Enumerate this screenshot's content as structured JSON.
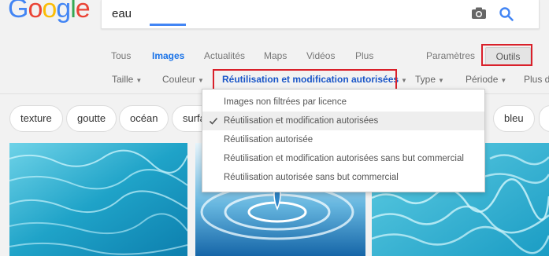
{
  "logo": {
    "text": "Google",
    "letters": [
      "G",
      "o",
      "o",
      "g",
      "l",
      "e"
    ],
    "colors": [
      "#4285F4",
      "#EA4335",
      "#FBBC05",
      "#4285F4",
      "#34A853",
      "#EA4335"
    ]
  },
  "search": {
    "query": "eau",
    "camera_icon": "camera-icon",
    "search_icon": "search-icon"
  },
  "tabs": [
    {
      "label": "Tous"
    },
    {
      "label": "Images",
      "active": true
    },
    {
      "label": "Actualités"
    },
    {
      "label": "Maps"
    },
    {
      "label": "Vidéos"
    },
    {
      "label": "Plus"
    },
    {
      "label": "Paramètres"
    }
  ],
  "tools_button": {
    "label": "Outils"
  },
  "filters": [
    {
      "label": "Taille"
    },
    {
      "label": "Couleur"
    },
    {
      "label": "Réutilisation et modification autorisées",
      "active": true
    },
    {
      "label": "Type"
    },
    {
      "label": "Période"
    },
    {
      "label": "Plus d"
    }
  ],
  "chips": [
    {
      "label": "texture"
    },
    {
      "label": "goutte"
    },
    {
      "label": "océan"
    },
    {
      "label": "surfa"
    },
    {
      "label": "bleu"
    }
  ],
  "dropdown": {
    "items": [
      {
        "label": "Images non filtrées par licence"
      },
      {
        "label": "Réutilisation et modification autorisées",
        "selected": true
      },
      {
        "label": "Réutilisation autorisée"
      },
      {
        "label": "Réutilisation et modification autorisées sans but commercial"
      },
      {
        "label": "Réutilisation autorisée sans but commercial"
      }
    ]
  },
  "colors": {
    "accent": "#1a73e8",
    "highlight": "#d9202a",
    "water": "#2aa8c9"
  }
}
